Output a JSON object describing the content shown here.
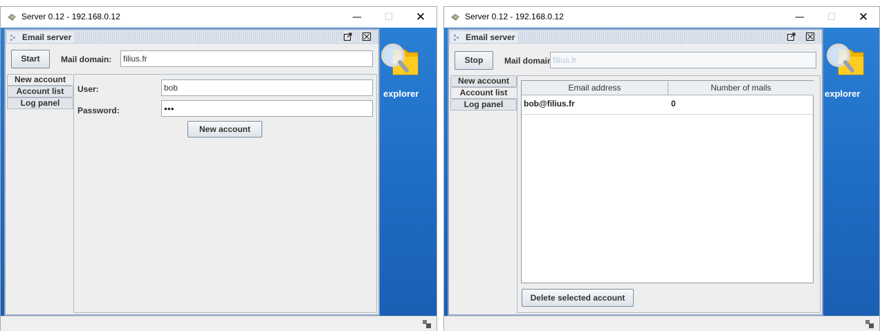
{
  "left": {
    "window_title": "Server 0.12 - 192.168.0.12",
    "desktop_label": "explorer",
    "frame_title": "Email server",
    "start_button": "Start",
    "mail_domain_label": "Mail domain:",
    "mail_domain_value": "filius.fr",
    "tabs": [
      "New account",
      "Account list",
      "Log panel"
    ],
    "selected_tab": "New account",
    "user_label": "User:",
    "user_value": "bob",
    "password_label": "Password:",
    "password_value": "•••",
    "new_account_button": "New account"
  },
  "right": {
    "window_title": "Server 0.12 - 192.168.0.12",
    "desktop_label": "explorer",
    "frame_title": "Email server",
    "stop_button": "Stop",
    "mail_domain_label": "Mail domain:",
    "mail_domain_value": "filius.fr",
    "tabs": [
      "New account",
      "Account list",
      "Log panel"
    ],
    "selected_tab": "Account list",
    "table": {
      "columns": [
        "Email address",
        "Number of mails"
      ],
      "rows": [
        [
          "bob@filius.fr",
          "0"
        ]
      ]
    },
    "delete_button": "Delete selected account"
  },
  "icons": {
    "app": "app-icon",
    "minimize": "minimize-icon",
    "maximize": "maximize-icon",
    "close": "close-icon",
    "frame": "frame-icon",
    "detach": "detach-icon",
    "frame_close": "frame-close-icon",
    "desktop": "magnifier-folder-icon",
    "resize": "resize-grip-icon"
  },
  "colors": {
    "desktop_blue": "#1e6cc4",
    "frame_border": "#8fa4c2"
  }
}
